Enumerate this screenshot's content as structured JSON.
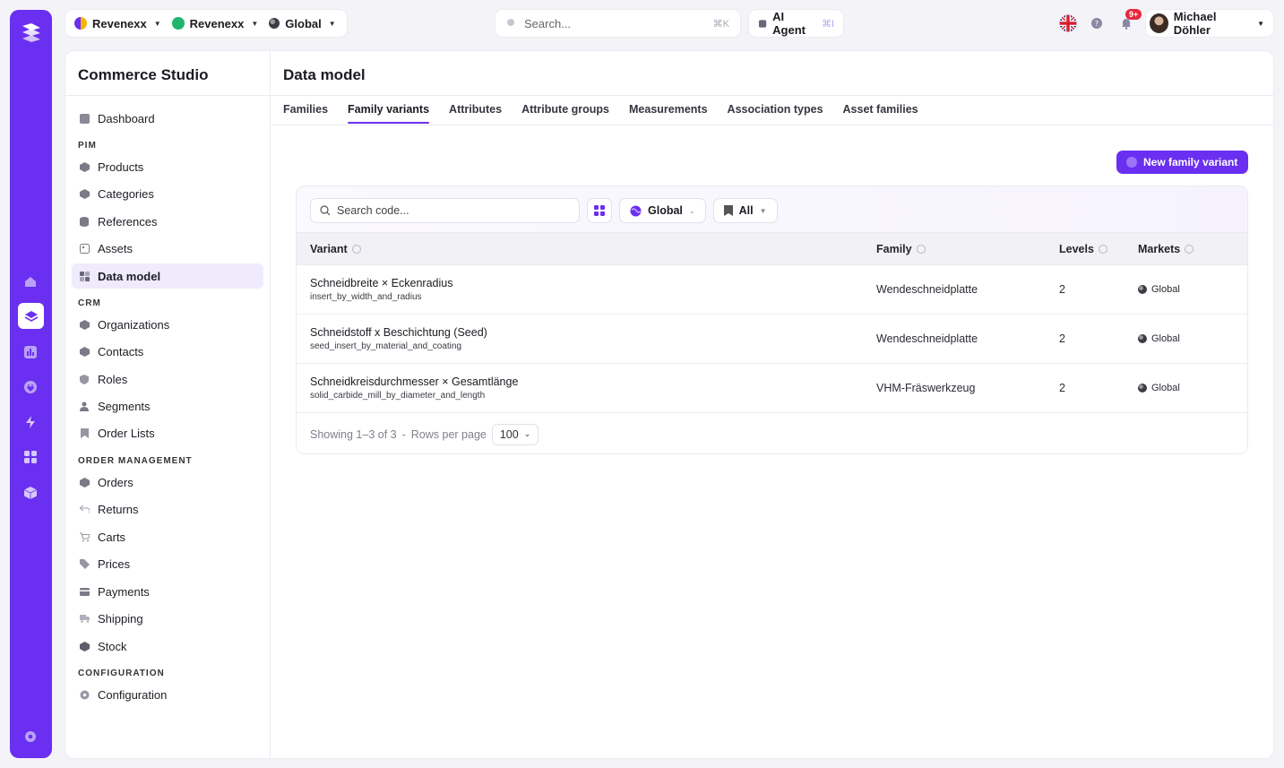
{
  "colors": {
    "accent": "#6a2ff0",
    "rail": "#6a2ff0",
    "badge": "#e8263e",
    "revenexx_green": "#1fb56d"
  },
  "topbar": {
    "tenant": "Revenexx",
    "project": "Revenexx",
    "market": "Global",
    "search_placeholder": "Search...",
    "search_shortcut": "⌘K",
    "agent_label": "AI Agent",
    "agent_shortcut": "⌘I",
    "notifications_badge": "9+",
    "user_name": "Michael Döhler"
  },
  "sidebar": {
    "title": "Commerce Studio",
    "dashboard": "Dashboard",
    "sections": {
      "pim": "PIM",
      "crm": "CRM",
      "order_management": "ORDER MANAGEMENT",
      "configuration": "CONFIGURATION"
    },
    "pim_items": [
      "Products",
      "Categories",
      "References",
      "Assets",
      "Data model"
    ],
    "crm_items": [
      "Organizations",
      "Contacts",
      "Roles",
      "Segments",
      "Order Lists"
    ],
    "om_items": [
      "Orders",
      "Returns",
      "Carts",
      "Prices",
      "Payments",
      "Shipping",
      "Stock"
    ],
    "config_items": [
      "Configuration"
    ]
  },
  "main": {
    "title": "Data model",
    "tabs": [
      "Families",
      "Family variants",
      "Attributes",
      "Attribute groups",
      "Measurements",
      "Association types",
      "Asset families"
    ],
    "active_tab": "Family variants",
    "new_button": "New family variant",
    "filters": {
      "search_placeholder": "Search code...",
      "market": "Global",
      "scope": "All"
    },
    "table": {
      "headers": [
        "Variant",
        "Family",
        "Levels",
        "Markets"
      ],
      "rows": [
        {
          "name": "Schneidbreite × Eckenradius",
          "code": "insert_by_width_and_radius",
          "family": "Wendeschneidplatte",
          "levels": "2",
          "markets": "Global"
        },
        {
          "name": "Schneidstoff x Beschichtung (Seed)",
          "code": "seed_insert_by_material_and_coating",
          "family": "Wendeschneidplatte",
          "levels": "2",
          "markets": "Global"
        },
        {
          "name": "Schneidkreisdurchmesser × Gesamtlänge",
          "code": "solid_carbide_mill_by_diameter_and_length",
          "family": "VHM-Fräswerkzeug",
          "levels": "2",
          "markets": "Global"
        }
      ]
    },
    "footer": {
      "showing": "Showing 1–3 of 3",
      "separator": "-",
      "rows_per_page_label": "Rows per page",
      "rows_per_page_value": "100"
    }
  }
}
